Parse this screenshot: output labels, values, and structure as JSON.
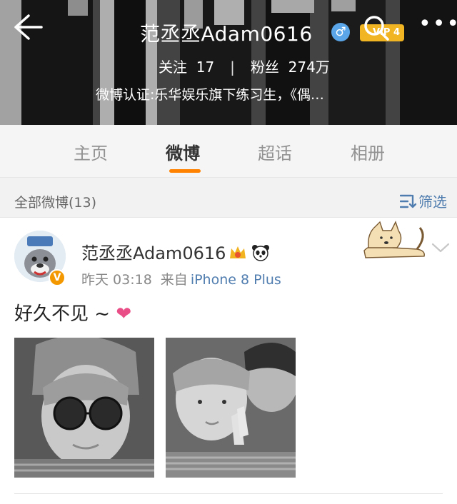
{
  "header": {
    "name": "范丞丞Adam0616",
    "gender_symbol": "♂",
    "vip_badge": "VIP 4",
    "more_label": "•••",
    "stats": {
      "following_label": "关注",
      "following_count": "17",
      "separator": "|",
      "followers_label": "粉丝",
      "followers_count": "274万"
    },
    "verification": "微博认证:乐华娱乐旗下练习生，《偶…"
  },
  "tabs": [
    {
      "label": "主页"
    },
    {
      "label": "微博"
    },
    {
      "label": "超话"
    },
    {
      "label": "相册"
    }
  ],
  "active_tab": "微博",
  "filter": {
    "label": "全部微博(13)",
    "button": "筛选"
  },
  "post": {
    "author": "范丞丞Adam0616",
    "verified_badge": "V",
    "time": "昨天 03:18",
    "source_prefix": "来自",
    "device": "iPhone 8 Plus",
    "text": "好久不见 ~",
    "heart": "❤",
    "photo_count": 2
  },
  "colors": {
    "accent": "#ff8200",
    "link": "#507daf",
    "vip": "#f1b524",
    "verified": "#f39800",
    "heart": "#e94e87"
  }
}
